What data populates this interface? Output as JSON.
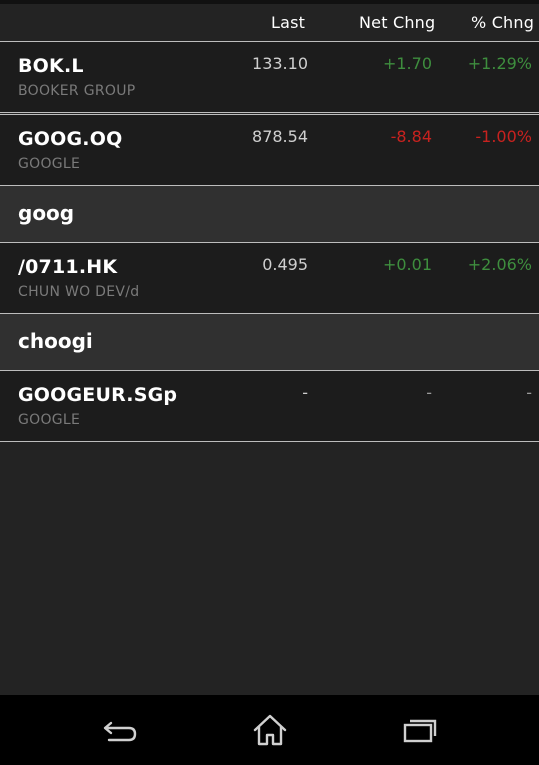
{
  "header": {
    "col_last": "Last",
    "col_net_change": "Net Chng",
    "col_pct_change": "% Chng"
  },
  "quotes": [
    {
      "symbol": "BOK.L",
      "name": "BOOKER GROUP",
      "last": "133.10",
      "net_change": "+1.70",
      "pct_change": "+1.29%",
      "direction": "up"
    },
    {
      "symbol": "GOOG.OQ",
      "name": "GOOGLE",
      "last": "878.54",
      "net_change": "-8.84",
      "pct_change": "-1.00%",
      "direction": "down"
    },
    {
      "symbol": "/0711.HK",
      "name": "CHUN WO DEV/d",
      "last": "0.495",
      "net_change": "+0.01",
      "pct_change": "+2.06%",
      "direction": "up"
    },
    {
      "symbol": "GOOGEUR.SGp",
      "name": "GOOGLE",
      "last": "-",
      "net_change": "-",
      "pct_change": "-",
      "direction": "flat"
    }
  ],
  "groups": [
    {
      "label": "goog"
    },
    {
      "label": "choogi"
    }
  ],
  "navbar": {
    "back_icon": "back-icon",
    "home_icon": "home-icon",
    "recent_icon": "recent-apps-icon"
  },
  "colors": {
    "positive": "#3e8e3e",
    "negative": "#c8221f",
    "background": "#232323",
    "navbar": "#000000"
  }
}
